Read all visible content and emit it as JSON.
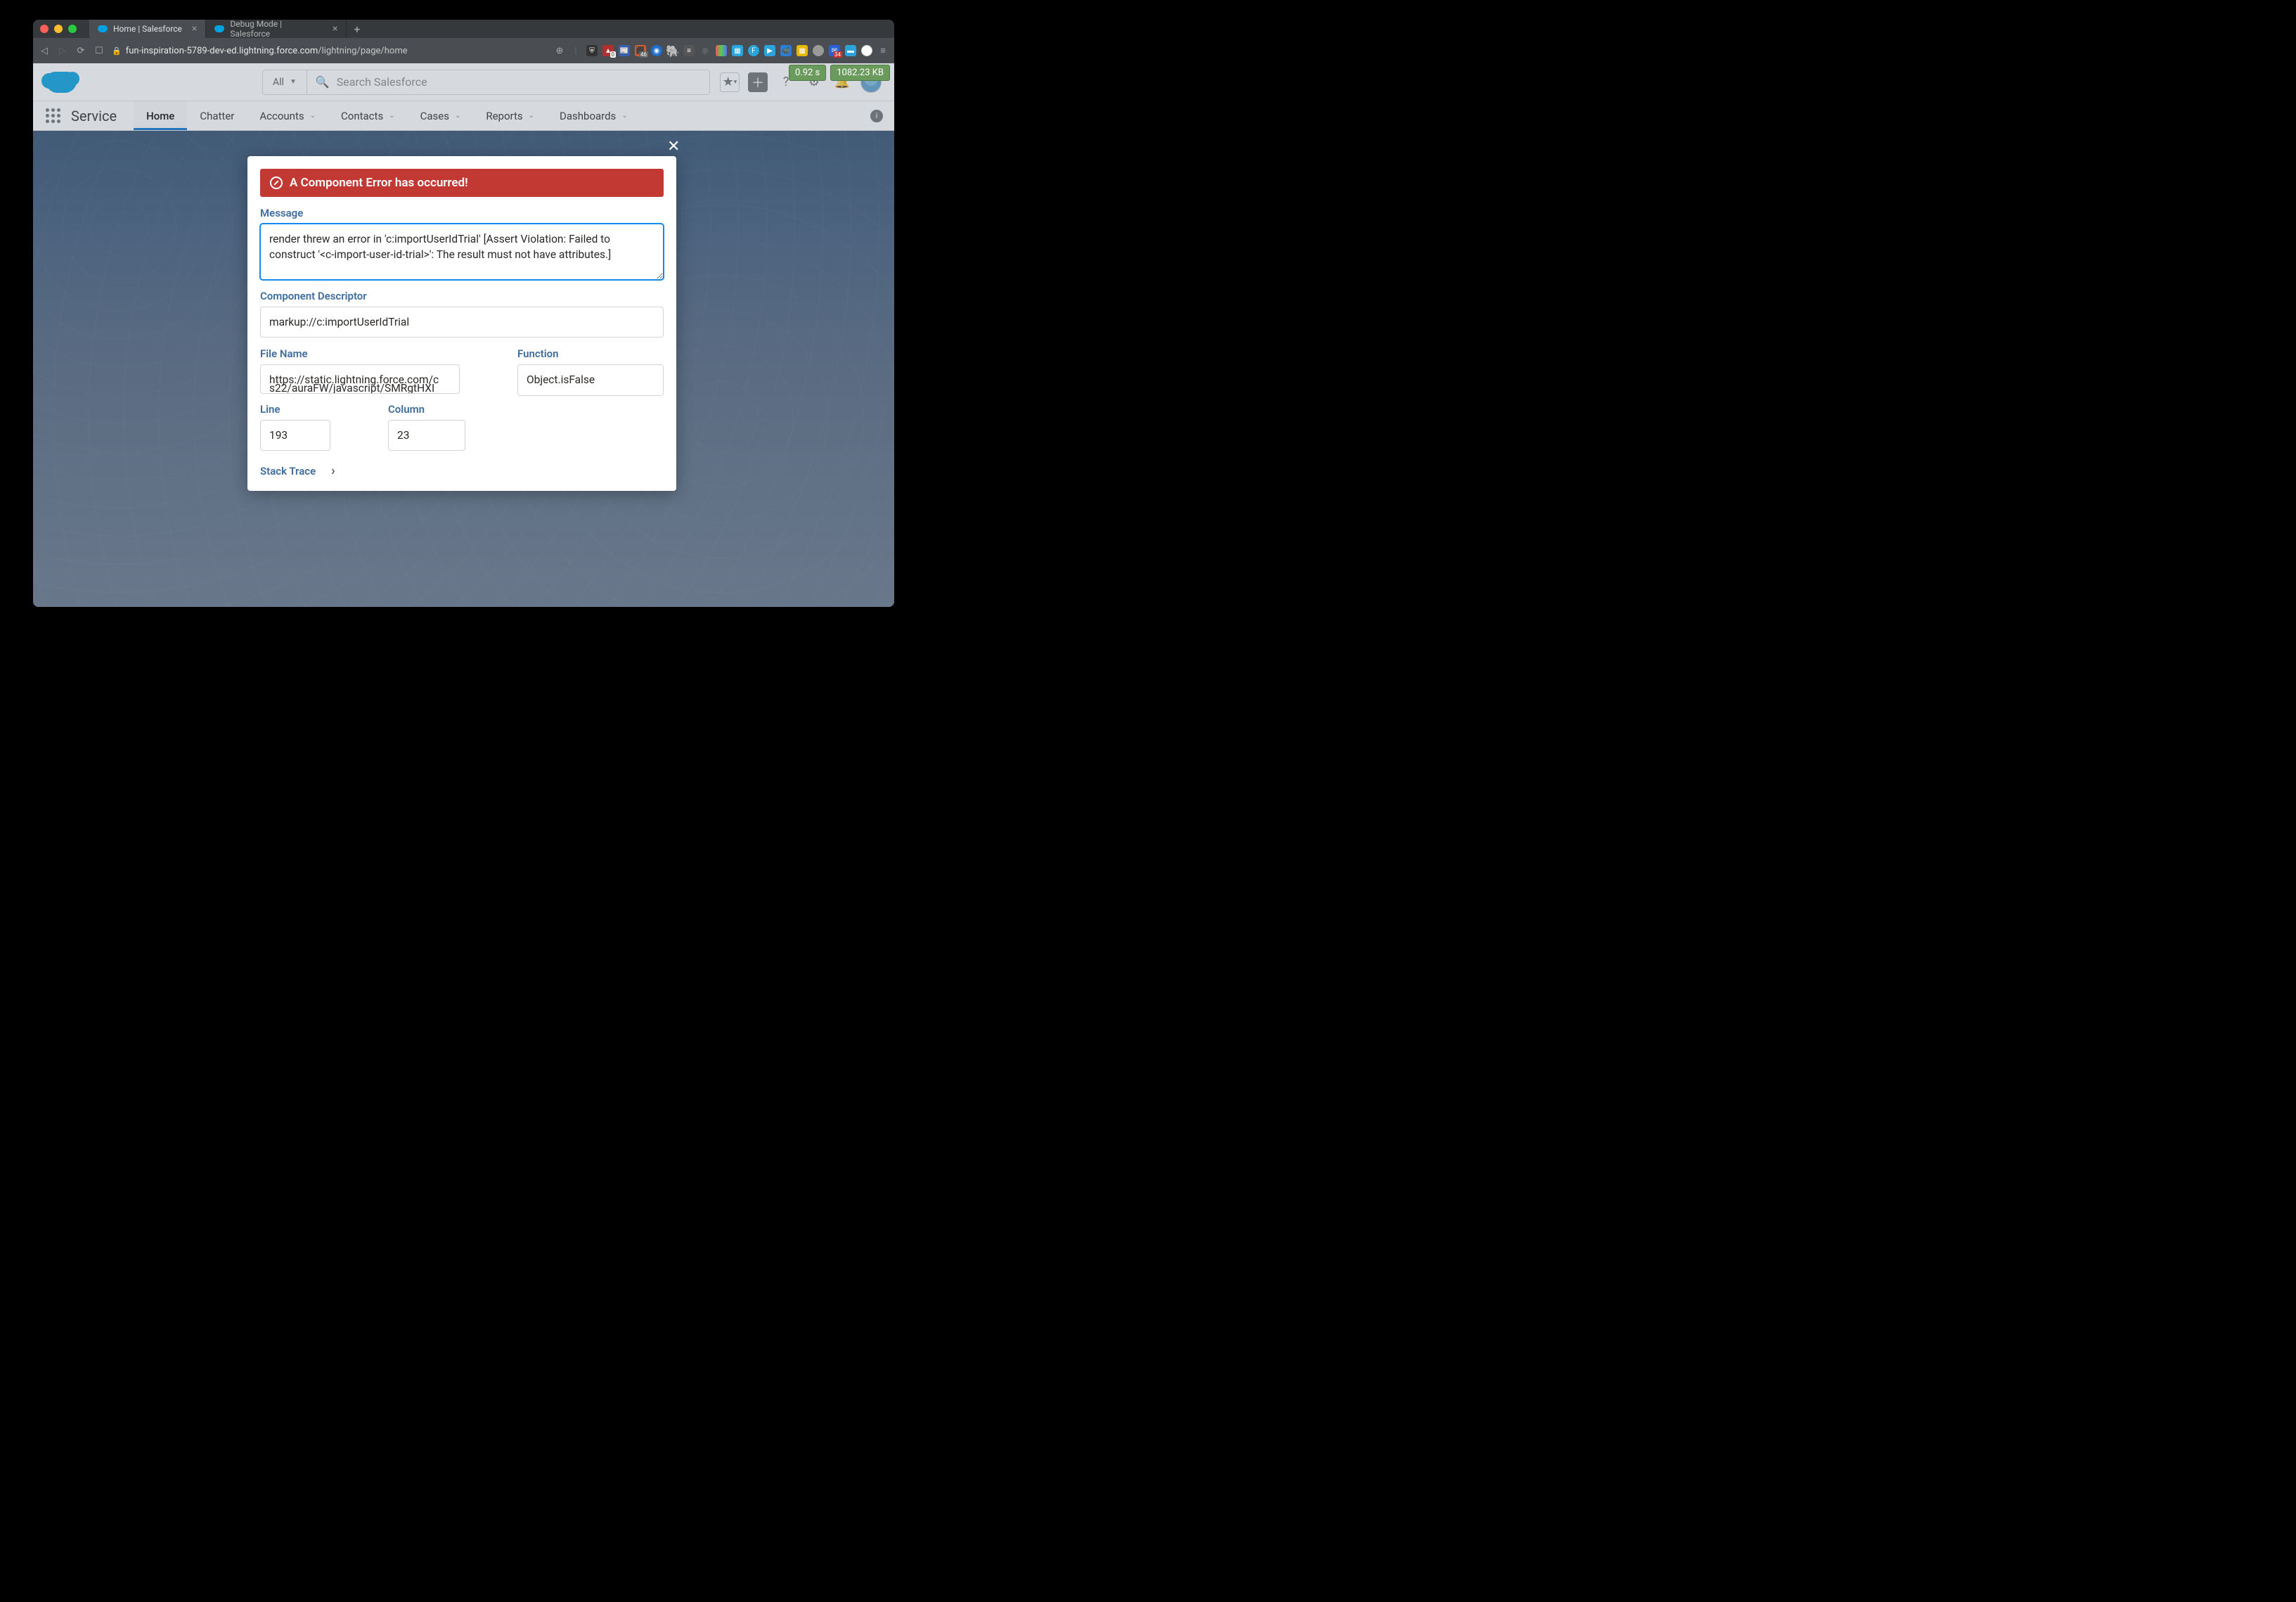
{
  "browser": {
    "tabs": [
      {
        "title": "Home | Salesforce",
        "active": true
      },
      {
        "title": "Debug Mode | Salesforce",
        "active": false
      }
    ],
    "url_host": "fun-inspiration-5789-dev-ed.lightning.force.com",
    "url_path": "/lightning/page/home",
    "ext_badge_1": "0",
    "ext_badge_2": "46",
    "ext_badge_3": "34"
  },
  "perf": {
    "time": "0.92 s",
    "size": "1082.23 KB"
  },
  "header": {
    "search_scope": "All",
    "search_placeholder": "Search Salesforce"
  },
  "nav": {
    "app_name": "Service",
    "items": [
      {
        "label": "Home",
        "active": true,
        "has_menu": false
      },
      {
        "label": "Chatter",
        "active": false,
        "has_menu": false
      },
      {
        "label": "Accounts",
        "active": false,
        "has_menu": true
      },
      {
        "label": "Contacts",
        "active": false,
        "has_menu": true
      },
      {
        "label": "Cases",
        "active": false,
        "has_menu": true
      },
      {
        "label": "Reports",
        "active": false,
        "has_menu": true
      },
      {
        "label": "Dashboards",
        "active": false,
        "has_menu": true
      }
    ]
  },
  "error": {
    "title": "A Component Error has occurred!",
    "labels": {
      "message": "Message",
      "descriptor": "Component Descriptor",
      "file": "File Name",
      "func": "Function",
      "line": "Line",
      "column": "Column",
      "stack": "Stack Trace"
    },
    "message": "render threw an error in 'c:importUserIdTrial' [Assert Violation: Failed to construct '<c-import-user-id-trial>': The result must not have attributes.]",
    "descriptor": "markup://c:importUserIdTrial",
    "file_line1": "https://static.lightning.force.com/c",
    "file_line2": "s22/auraFW/javascript/SMRgtHXI",
    "func": "Object.isFalse",
    "line": "193",
    "column": "23"
  }
}
